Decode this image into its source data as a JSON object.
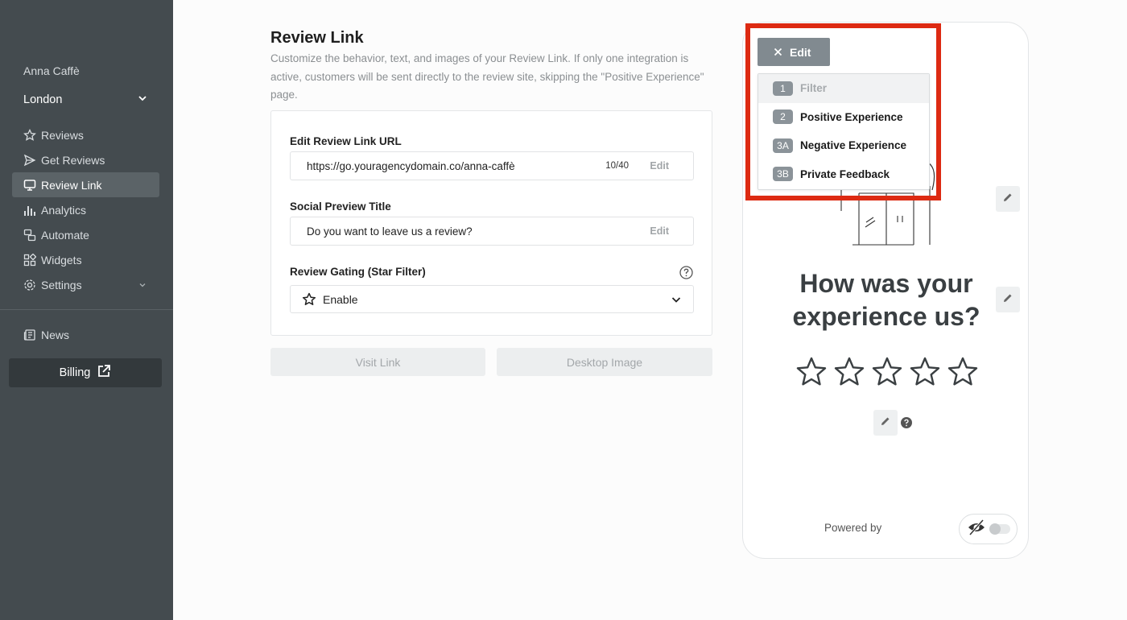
{
  "sidebar": {
    "business_name": "Anna Caffè",
    "location": "London",
    "items": [
      {
        "label": "Reviews",
        "icon": "star-icon"
      },
      {
        "label": "Get Reviews",
        "icon": "send-icon"
      },
      {
        "label": "Review Link",
        "icon": "monitor-icon",
        "active": true
      },
      {
        "label": "Analytics",
        "icon": "bar-chart-icon"
      },
      {
        "label": "Automate",
        "icon": "automate-icon"
      },
      {
        "label": "Widgets",
        "icon": "widgets-icon"
      },
      {
        "label": "Settings",
        "icon": "gear-icon"
      }
    ],
    "news_label": "News",
    "billing_label": "Billing"
  },
  "main": {
    "title": "Review Link",
    "description": "Customize the behavior, text, and images of your Review Link. If only one integration is active, customers will be sent directly to the review site, skipping the \"Positive Experience\" page.",
    "url_label": "Edit Review Link URL",
    "url_value": "https://go.youragencydomain.co/anna-caffè",
    "url_count": "10/40",
    "url_edit": "Edit",
    "social_label": "Social Preview Title",
    "social_value": "Do you want to leave us a review?",
    "social_edit": "Edit",
    "gating_label": "Review Gating (Star Filter)",
    "gating_value": "Enable",
    "visit_link": "Visit Link",
    "desktop_image": "Desktop Image"
  },
  "preview": {
    "headline": "How was your experience us?",
    "powered_by": "Powered by",
    "star_count": 5
  },
  "edit_menu": {
    "button_label": "Edit",
    "items": [
      {
        "badge": "1",
        "label": "Filter",
        "disabled": true
      },
      {
        "badge": "2",
        "label": "Positive Experience"
      },
      {
        "badge": "3A",
        "label": "Negative Experience"
      },
      {
        "badge": "3B",
        "label": "Private Feedback"
      }
    ]
  },
  "colors": {
    "sidebar_bg": "#444b4f",
    "highlight": "#dd2a12",
    "edit_button": "#818a90"
  }
}
